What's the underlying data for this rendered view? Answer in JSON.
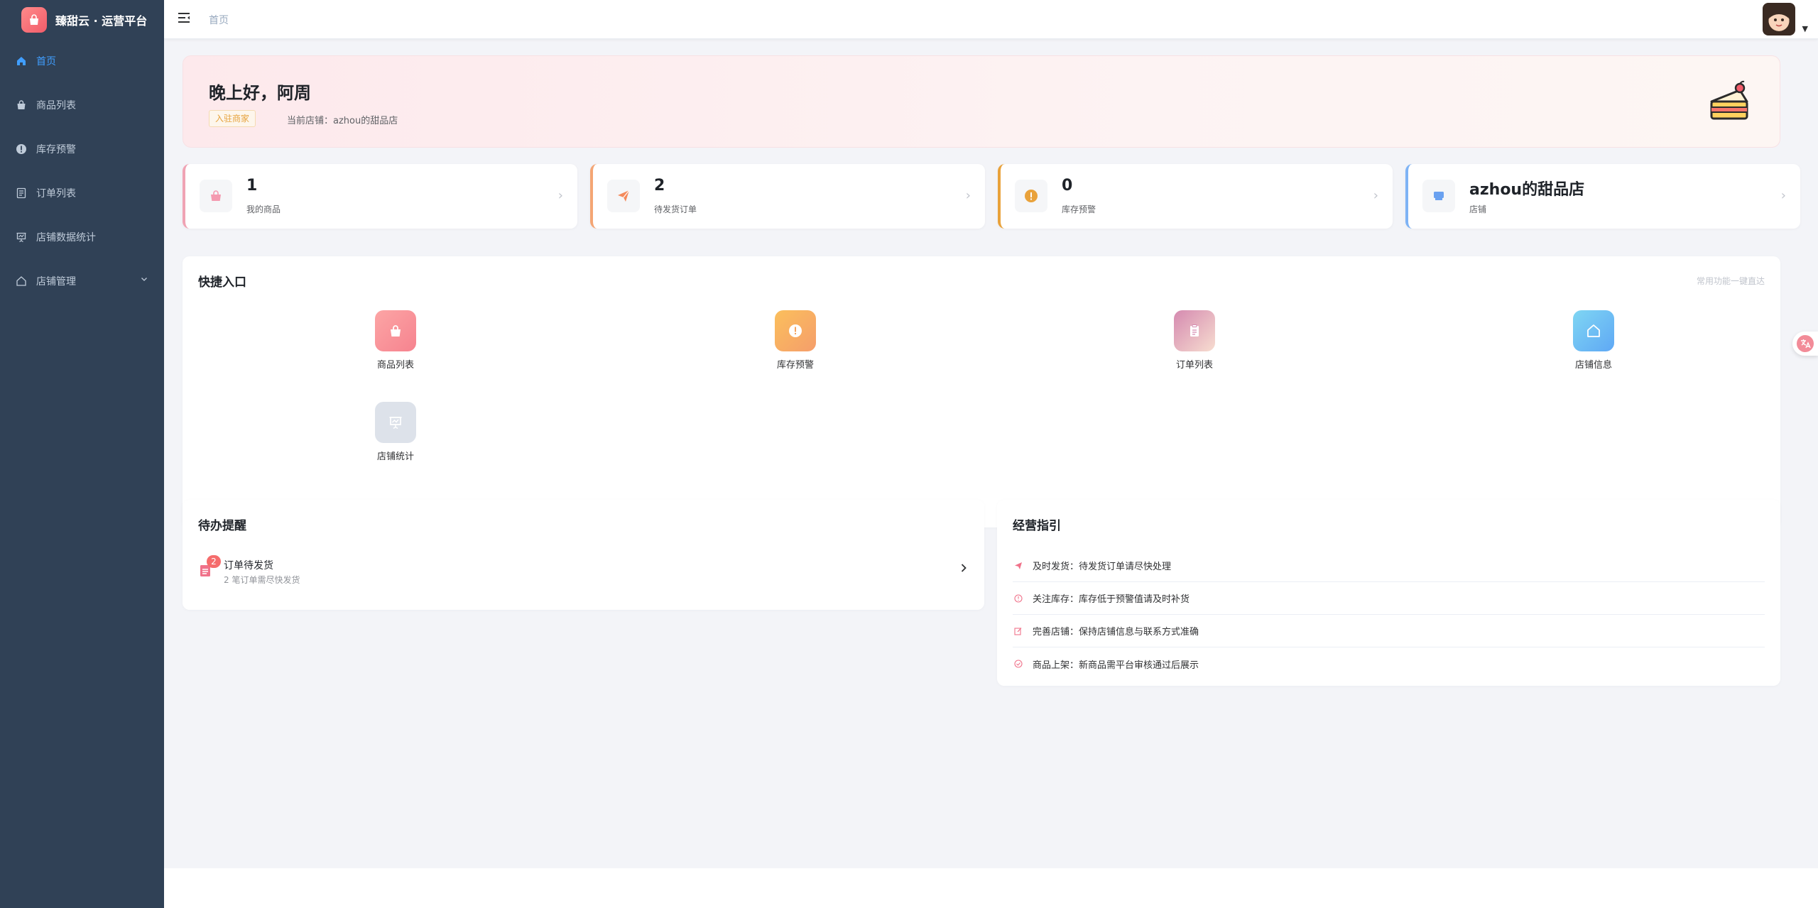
{
  "app": {
    "title": "臻甜云 · 运营平台"
  },
  "sidebar": {
    "items": [
      {
        "label": "首页"
      },
      {
        "label": "商品列表"
      },
      {
        "label": "库存预警"
      },
      {
        "label": "订单列表"
      },
      {
        "label": "店铺数据统计"
      },
      {
        "label": "店铺管理"
      }
    ]
  },
  "header": {
    "breadcrumb": "首页"
  },
  "greeting": {
    "title": "晚上好，阿周",
    "tag": "入驻商家",
    "store": "当前店铺：azhou的甜品店"
  },
  "stats": [
    {
      "value": "1",
      "label": "我的商品",
      "color": "#f0a3b4"
    },
    {
      "value": "2",
      "label": "待发货订单",
      "color": "#f4a574"
    },
    {
      "value": "0",
      "label": "库存预警",
      "color": "#e9a23b"
    },
    {
      "value": "azhou的甜品店",
      "label": "店铺",
      "color": "#7eb3f5"
    }
  ],
  "quick": {
    "title": "快捷入口",
    "hint": "常用功能一键直达",
    "items": [
      {
        "label": "商品列表",
        "icon": "shopping-bag-icon"
      },
      {
        "label": "库存预警",
        "icon": "warning-icon"
      },
      {
        "label": "订单列表",
        "icon": "clipboard-icon"
      },
      {
        "label": "店铺信息",
        "icon": "house-icon"
      },
      {
        "label": "店铺统计",
        "icon": "chart-board-icon"
      }
    ]
  },
  "todo": {
    "title": "待办提醒",
    "items": [
      {
        "badge": "2",
        "title": "订单待发货",
        "sub": "2 笔订单需尽快发货"
      }
    ]
  },
  "guide": {
    "title": "经营指引",
    "items": [
      {
        "text": "及时发货：待发货订单请尽快处理"
      },
      {
        "text": "关注库存：库存低于预警值请及时补货"
      },
      {
        "text": "完善店铺：保持店铺信息与联系方式准确"
      },
      {
        "text": "商品上架：新商品需平台审核通过后展示"
      }
    ]
  },
  "colors": {
    "accent": "#409eff",
    "sidebar": "#304156",
    "brand": "#f25c6a",
    "danger": "#f56c6c"
  }
}
